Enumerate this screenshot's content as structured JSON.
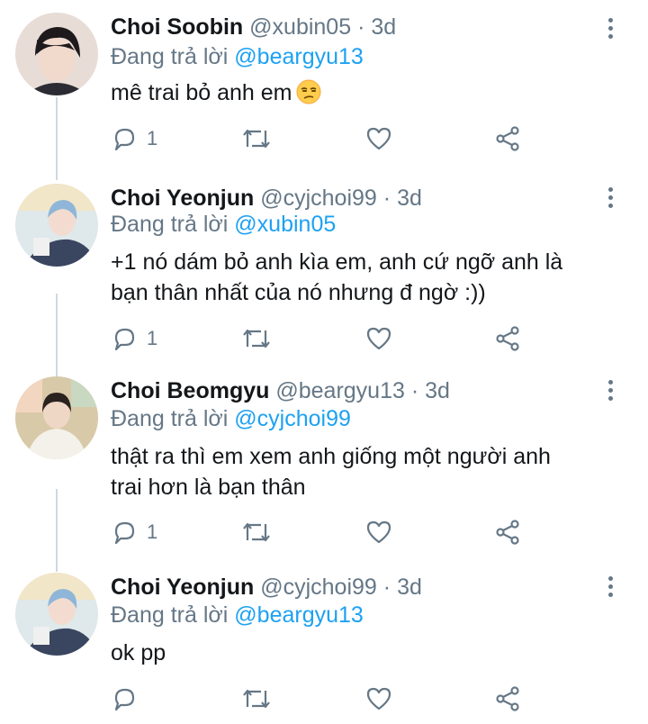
{
  "tweets": [
    {
      "name": "Choi Soobin",
      "handle": "@xubin05",
      "separator": "·",
      "time": "3d",
      "reply_prefix": "Đang trả lời",
      "reply_to": "@beargyu13",
      "body_lines": [
        "mê trai bỏ anh em"
      ],
      "emoji": "unamused-face-emoji",
      "reply_count": "1",
      "avatar_colors": {
        "bg": "#e8dcd6",
        "hair": "#1e1a1c",
        "skin": "#f1d9cc",
        "shirt": "#2b2b33"
      }
    },
    {
      "name": "Choi Yeonjun",
      "handle": "@cyjchoi99",
      "separator": "·",
      "time": "3d",
      "reply_prefix": "Đang trả lời",
      "reply_to": "@xubin05",
      "body_lines": [
        "+1 nó dám bỏ anh kìa em, anh cứ ngỡ anh là",
        "bạn thân nhất của nó nhưng đ ngờ :))"
      ],
      "reply_count": "1",
      "avatar_colors": {
        "bg": "#dfe8ea",
        "hair": "#8fb6d8",
        "skin": "#f3dccf",
        "shirt": "#3a4660"
      }
    },
    {
      "name": "Choi Beomgyu",
      "handle": "@beargyu13",
      "separator": "·",
      "time": "3d",
      "reply_prefix": "Đang trả lời",
      "reply_to": "@cyjchoi99",
      "body_lines": [
        "thật ra thì em xem anh giống một người anh",
        "trai hơn là bạn thân"
      ],
      "reply_count": "1",
      "avatar_colors": {
        "bg": "#d8c9a8",
        "hair": "#2a221e",
        "skin": "#efd7c6",
        "shirt": "#f4f1ea"
      }
    },
    {
      "name": "Choi Yeonjun",
      "handle": "@cyjchoi99",
      "separator": "·",
      "time": "3d",
      "reply_prefix": "Đang trả lời",
      "reply_to": "@beargyu13",
      "body_lines": [
        "ok pp"
      ],
      "reply_count": "",
      "avatar_colors": {
        "bg": "#dfe8ea",
        "hair": "#8fb6d8",
        "skin": "#f3dccf",
        "shirt": "#3a4660"
      }
    }
  ],
  "icons": {
    "reply": "reply-bubble-icon",
    "retweet": "retweet-icon",
    "like": "heart-icon",
    "share": "share-icon",
    "more": "more-vertical-icon"
  },
  "colors": {
    "text": "#14171a",
    "muted": "#657786",
    "accent": "#1da1f2",
    "thread_line": "#cfd9de"
  }
}
